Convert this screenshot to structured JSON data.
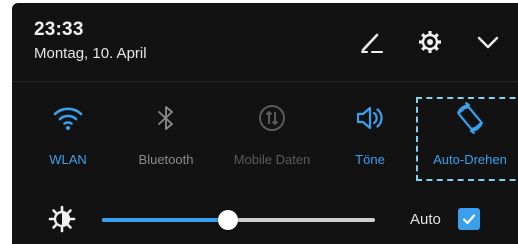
{
  "header": {
    "time": "23:33",
    "date": "Montag, 10. April"
  },
  "icons": {
    "edit": "edit-pencil-icon",
    "settings": "gear-icon",
    "expand": "chevron-down-icon"
  },
  "toggles": [
    {
      "label": "WLAN",
      "icon": "wifi-icon",
      "state": "on"
    },
    {
      "label": "Bluetooth",
      "icon": "bluetooth-icon",
      "state": "off"
    },
    {
      "label": "Mobile Daten",
      "icon": "mobile-data-icon",
      "state": "disabled"
    },
    {
      "label": "Töne",
      "icon": "speaker-icon",
      "state": "on"
    },
    {
      "label": "Auto-Drehen",
      "icon": "auto-rotate-icon",
      "state": "on"
    }
  ],
  "brightness": {
    "level": 0.46,
    "auto_label": "Auto",
    "auto_checked": true
  },
  "colors": {
    "panel_bg": "#121212",
    "accent": "#3aa0ee",
    "inactive": "#8a8a8a",
    "disabled": "#5a5a5a",
    "highlight": "#7fd3ef"
  }
}
